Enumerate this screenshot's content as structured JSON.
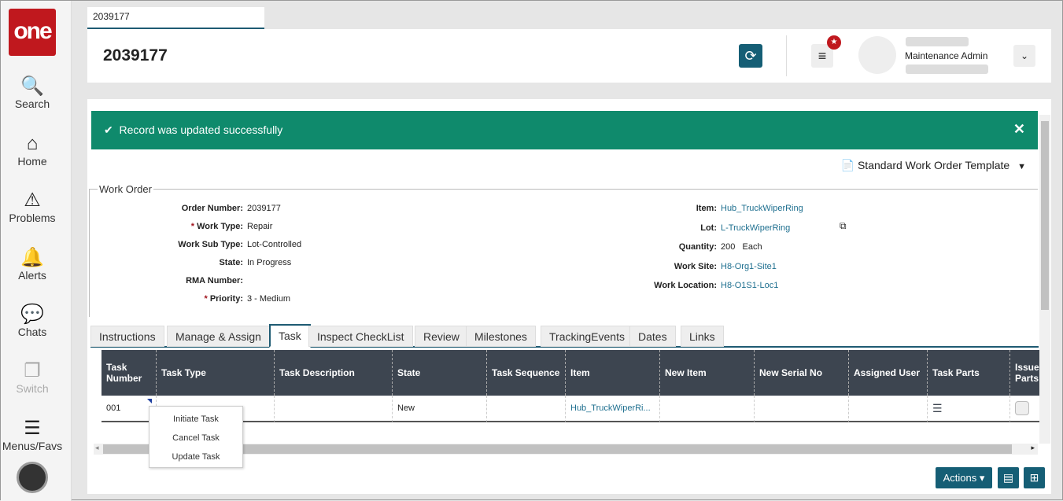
{
  "sidebar": {
    "logo": "one",
    "items": [
      {
        "label": "Search",
        "icon": "🔍"
      },
      {
        "label": "Home",
        "icon": "⌂"
      },
      {
        "label": "Problems",
        "icon": "⚠"
      },
      {
        "label": "Alerts",
        "icon": "🔔"
      },
      {
        "label": "Chats",
        "icon": "💬"
      },
      {
        "label": "Switch",
        "icon": "❐"
      },
      {
        "label": "Menus/Favs",
        "icon": "☰"
      }
    ]
  },
  "page_tab": "2039177",
  "header": {
    "title": "2039177",
    "role": "Maintenance Admin",
    "refresh_icon": "⟳",
    "menu_icon": "≡",
    "star_icon": "★",
    "dropdown_icon": "⌄"
  },
  "banner": {
    "message": "Record was updated successfully",
    "check": "✔",
    "close": "✕"
  },
  "template": {
    "label": "Standard Work Order Template",
    "icon": "📄",
    "caret": "▼"
  },
  "work_order": {
    "legend": "Work Order",
    "left": [
      {
        "label": "Order Number:",
        "value": "2039177",
        "req": ""
      },
      {
        "label": "Work Type:",
        "value": "Repair",
        "req": "*"
      },
      {
        "label": "Work Sub Type:",
        "value": "Lot-Controlled",
        "req": ""
      },
      {
        "label": "State:",
        "value": "In Progress",
        "req": ""
      },
      {
        "label": "RMA Number:",
        "value": "",
        "req": ""
      },
      {
        "label": "Priority:",
        "value": "3 - Medium",
        "req": "*"
      }
    ],
    "right": [
      {
        "label": "Item:",
        "value": "Hub_TruckWiperRing",
        "link": true
      },
      {
        "label": "Lot:",
        "value": "L-TruckWiperRing",
        "link": true
      },
      {
        "label": "Quantity:",
        "value": "200   Each",
        "link": false
      },
      {
        "label": "Work Site:",
        "value": "H8-Org1-Site1",
        "link": true
      },
      {
        "label": "Work Location:",
        "value": "H8-O1S1-Loc1",
        "link": true
      }
    ]
  },
  "tabs": [
    "Instructions",
    "Manage & Assign",
    "Task",
    "Inspect CheckList",
    "Review",
    "Milestones",
    "TrackingEvents",
    "Dates",
    "Links"
  ],
  "active_tab": "Task",
  "table": {
    "columns": [
      "Task Number",
      "Task Type",
      "Task Description",
      "State",
      "Task Sequence",
      "Item",
      "New Item",
      "New Serial No",
      "Assigned User",
      "Task Parts",
      "Issue Parts"
    ],
    "rows": [
      [
        "001",
        "",
        "",
        "New",
        "",
        "Hub_TruckWiperRi...",
        "",
        "",
        "",
        "",
        ""
      ]
    ]
  },
  "context_menu": [
    "Initiate Task",
    "Cancel Task",
    "Update Task"
  ],
  "footer": {
    "actions": "Actions ▾"
  }
}
